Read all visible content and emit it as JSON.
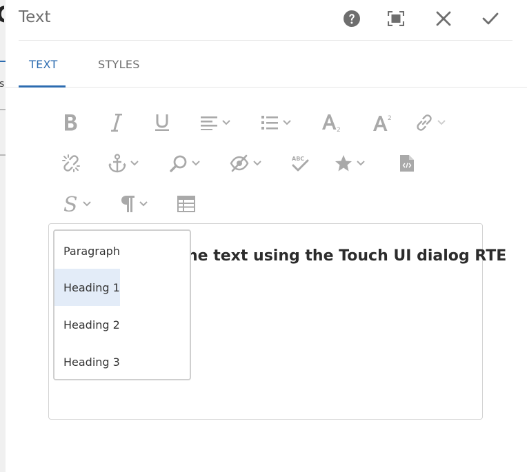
{
  "dialog": {
    "title": "Text"
  },
  "header": {
    "help_icon": "help-circle-icon",
    "fullscreen_icon": "fullscreen-icon",
    "close_icon": "close-icon",
    "done_icon": "checkmark-icon"
  },
  "tabs": [
    {
      "label": "TEXT",
      "active": true
    },
    {
      "label": "STYLES",
      "active": false
    }
  ],
  "toolbar": {
    "rows": [
      [
        "bold-icon",
        "italic-icon",
        "underline-icon",
        "justify-icon",
        "list-icon",
        "subscript-icon",
        "superscript-icon",
        "link-icon"
      ],
      [
        "unlink-icon",
        "anchor-icon",
        "find-icon",
        "image-props-icon",
        "spellcheck-icon",
        "special-chars-icon",
        "source-edit-icon"
      ],
      [
        "styles-icon",
        "paragraph-format-icon",
        "table-icon"
      ]
    ]
  },
  "editor": {
    "visible_text": "he text using the Touch UI dialog RTE"
  },
  "paragraph_menu": {
    "items": [
      "Paragraph",
      "Heading 1",
      "Heading 2",
      "Heading 3"
    ],
    "selected": "Heading 1"
  },
  "colors": {
    "accent": "#2c6cb0",
    "icon_gray": "#a9a9a9",
    "header_icon": "#6e6e6e",
    "selected_bg": "#e3ecf8"
  },
  "background_page": {
    "partial_text": "s"
  }
}
